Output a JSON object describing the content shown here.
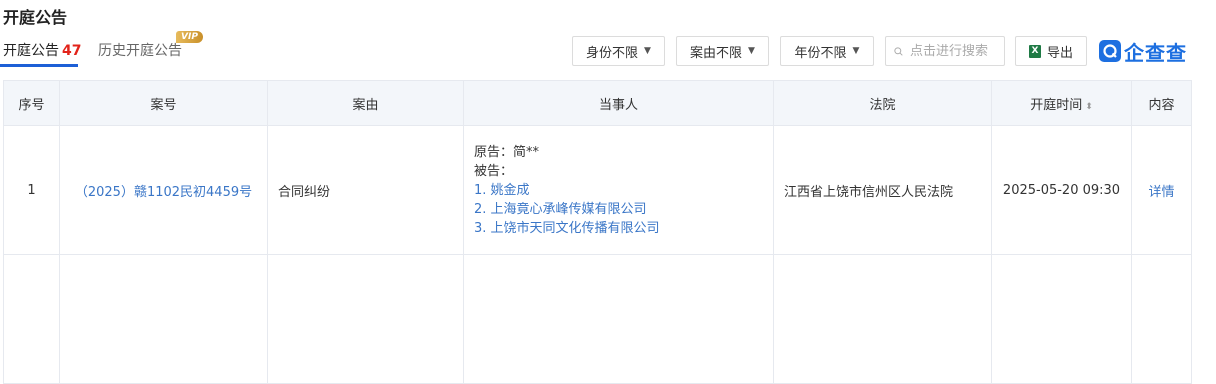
{
  "page": {
    "title": "开庭公告"
  },
  "tabs": [
    {
      "label": "开庭公告",
      "count": "47"
    },
    {
      "label": "历史开庭公告",
      "badge": "VIP"
    }
  ],
  "filters": [
    "身份不限",
    "案由不限",
    "年份不限"
  ],
  "search": {
    "placeholder": "点击进行搜索"
  },
  "export": {
    "label": "导出",
    "icon": "excel-icon"
  },
  "brand": {
    "name": "企查查"
  },
  "table": {
    "headers": [
      "序号",
      "案号",
      "案由",
      "当事人",
      "法院",
      "开庭时间",
      "内容"
    ],
    "rows": [
      {
        "index": "1",
        "case_no": "（2025）赣1102民初4459号",
        "cause": "合同纠纷",
        "plaintiff_label": "原告：简**",
        "defendant_label": "被告：",
        "defendants": [
          "1. 姚金成",
          "2. 上海竟心承峰传媒有限公司",
          "3. 上饶市天同文化传播有限公司"
        ],
        "court": "江西省上饶市信州区人民法院",
        "time": "2025-05-20 09:30",
        "action": "详情"
      }
    ]
  },
  "colors": {
    "link": "#3a76c7",
    "accent": "#1d5fd6",
    "count": "#e2231a"
  }
}
